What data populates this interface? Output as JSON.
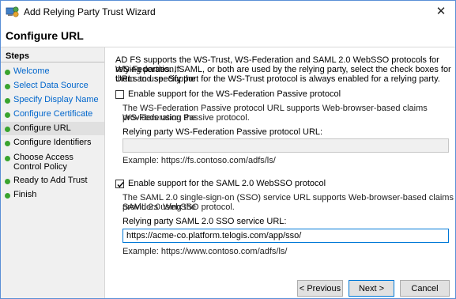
{
  "window": {
    "title": "Add Relying Party Trust Wizard",
    "close_glyph": "✕"
  },
  "header": {
    "page_title": "Configure URL"
  },
  "sidebar": {
    "heading": "Steps",
    "items": [
      {
        "label": "Welcome",
        "state": "done"
      },
      {
        "label": "Select Data Source",
        "state": "done"
      },
      {
        "label": "Specify Display Name",
        "state": "done"
      },
      {
        "label": "Configure Certificate",
        "state": "done"
      },
      {
        "label": "Configure URL",
        "state": "current"
      },
      {
        "label": "Configure Identifiers",
        "state": "pending"
      },
      {
        "label": "Choose Access Control Policy",
        "state": "pending"
      },
      {
        "label": "Ready to Add Trust",
        "state": "pending"
      },
      {
        "label": "Finish",
        "state": "pending"
      }
    ]
  },
  "main": {
    "intro": [
      "AD FS supports the WS-Trust, WS-Federation and SAML 2.0 WebSSO protocols for relying parties.  If",
      "WS-Federation, SAML, or both are used by the relying party, select the check boxes for them and specify the",
      "URLs to use.  Support for the WS-Trust protocol is always enabled for a relying party."
    ],
    "wsfed": {
      "checkbox_label": "Enable support for the WS-Federation Passive protocol",
      "checked": false,
      "description": [
        "The WS-Federation Passive protocol URL supports Web-browser-based claims providers using the",
        "WS-Federation Passive protocol."
      ],
      "url_label": "Relying party WS-Federation Passive protocol URL:",
      "url_value": "",
      "example": "Example: https://fs.contoso.com/adfs/ls/"
    },
    "saml": {
      "checkbox_label": "Enable support for the SAML 2.0 WebSSO protocol",
      "checked": true,
      "description": [
        "The SAML 2.0 single-sign-on (SSO) service URL supports Web-browser-based claims providers using the",
        "SAML 2.0 WebSSO protocol."
      ],
      "url_label": "Relying party SAML 2.0 SSO service URL:",
      "url_value": "https://acme-co.platform.telogis.com/app/sso/",
      "example": "Example: https://www.contoso.com/adfs/ls/"
    }
  },
  "footer": {
    "previous_label": "< Previous",
    "next_label": "Next >",
    "cancel_label": "Cancel"
  },
  "colors": {
    "link": "#0066cc",
    "step_done": "#3aa42f",
    "focus": "#0078d7",
    "window_border": "#5a8fd6"
  }
}
